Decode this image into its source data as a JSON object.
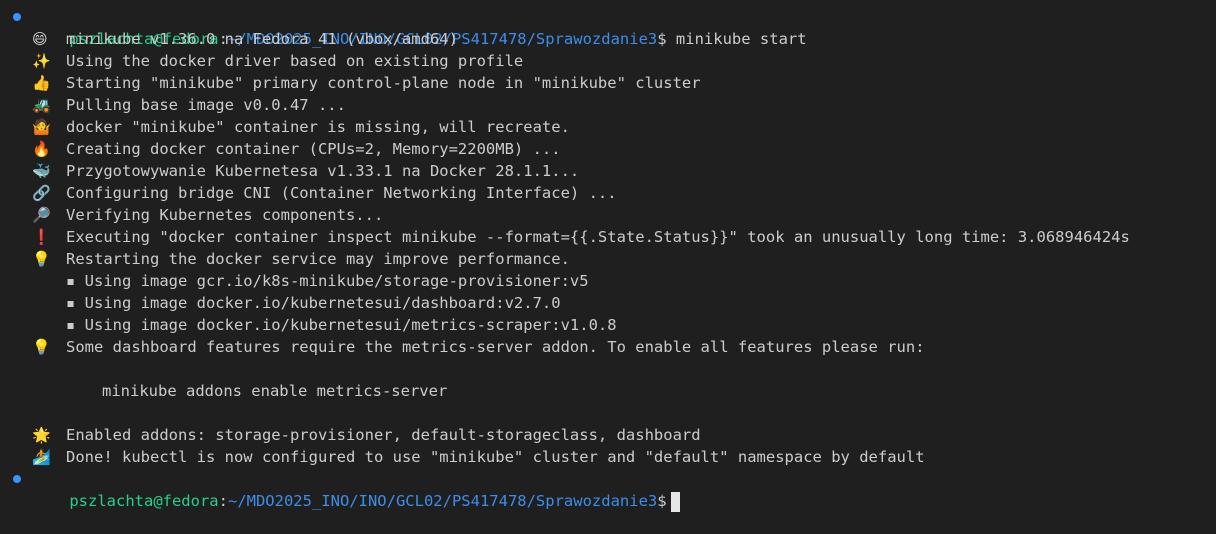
{
  "prompt": {
    "user_host": "pszlachta@fedora",
    "sep": ":",
    "path": "~/MDO2025_INO/INO/GCL02/PS417478/Sprawozdanie3",
    "dollar": "$",
    "command": " minikube start"
  },
  "output": [
    {
      "icon": "😄",
      "icon_name": "smiling-face-icon",
      "text": "minikube v1.36.0 na Fedora 41 (vbox/amd64)"
    },
    {
      "icon": "✨",
      "icon_name": "sparkles-icon",
      "text": "Using the docker driver based on existing profile"
    },
    {
      "icon": "👍",
      "icon_name": "thumbs-up-icon",
      "text": "Starting \"minikube\" primary control-plane node in \"minikube\" cluster"
    },
    {
      "icon": "🚜",
      "icon_name": "tractor-icon",
      "text": "Pulling base image v0.0.47 ..."
    },
    {
      "icon": "🤷",
      "icon_name": "shrug-icon",
      "text": "docker \"minikube\" container is missing, will recreate."
    },
    {
      "icon": "🔥",
      "icon_name": "fire-icon",
      "text": "Creating docker container (CPUs=2, Memory=2200MB) ..."
    },
    {
      "icon": "🐳",
      "icon_name": "whale-icon",
      "text": "Przygotowywanie Kubernetesa v1.33.1 na Docker 28.1.1..."
    },
    {
      "icon": "🔗",
      "icon_name": "link-icon",
      "text": "Configuring bridge CNI (Container Networking Interface) ..."
    },
    {
      "icon": "🔎",
      "icon_name": "magnifier-icon",
      "text": "Verifying Kubernetes components..."
    },
    {
      "icon": "❗",
      "icon_name": "exclamation-icon",
      "text": "Executing \"docker container inspect minikube --format={{.State.Status}}\" took an unusually long time: 3.068946424s"
    },
    {
      "icon": "💡",
      "icon_name": "lightbulb-icon",
      "text": "Restarting the docker service may improve performance."
    }
  ],
  "images": [
    "▪ Using image gcr.io/k8s-minikube/storage-provisioner:v5",
    "▪ Using image docker.io/kubernetesui/dashboard:v2.7.0",
    "▪ Using image docker.io/kubernetesui/metrics-scraper:v1.0.8"
  ],
  "hint": {
    "icon": "💡",
    "icon_name": "lightbulb-icon",
    "text": "Some dashboard features require the metrics-server addon. To enable all features please run:"
  },
  "hint_command": "minikube addons enable metrics-server",
  "final": [
    {
      "icon": "🌟",
      "icon_name": "star-icon",
      "text": "Enabled addons: storage-provisioner, default-storageclass, dashboard"
    },
    {
      "icon": "🏄",
      "icon_name": "surfer-icon",
      "text": "Done! kubectl is now configured to use \"minikube\" cluster and \"default\" namespace by default"
    }
  ],
  "prompt2": {
    "user_host": "pszlachta@fedora",
    "sep": ":",
    "path": "~/MDO2025_INO/INO/GCL02/PS417478/Sprawozdanie3",
    "dollar": "$"
  },
  "colors": {
    "background": "#1f1f1f",
    "user": "#23d18b",
    "path": "#3b8eea",
    "text": "#cccccc",
    "dot": "#3794ff"
  }
}
